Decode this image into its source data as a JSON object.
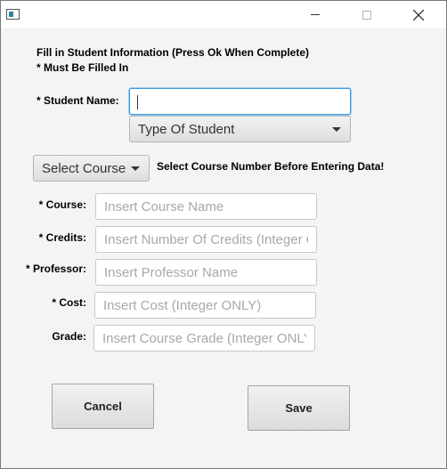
{
  "window": {
    "minimize_icon": "minimize-icon",
    "maximize_icon": "maximize-icon",
    "close_icon": "close-icon",
    "app_icon": "app-icon"
  },
  "header": {
    "instructions": "Fill in Student Information (Press Ok When Complete)",
    "required_note": "* Must Be Filled In"
  },
  "student": {
    "name_label": "* Student Name:",
    "name_value": "",
    "type_combo": "Type Of Student"
  },
  "course_select": {
    "combo": "Select Course",
    "hint": "Select Course Number Before Entering Data!"
  },
  "fields": [
    {
      "label": "* Course:",
      "placeholder": "Insert Course Name"
    },
    {
      "label": "* Credits:",
      "placeholder": "Insert Number Of Credits (Integer ONLY)"
    },
    {
      "label": "* Professor:",
      "placeholder": "Insert Professor Name"
    },
    {
      "label": "* Cost:",
      "placeholder": "Insert Cost (Integer ONLY)"
    },
    {
      "label": "Grade:",
      "placeholder": "Insert Course Grade (Integer ONLY)"
    }
  ],
  "buttons": {
    "cancel": "Cancel",
    "save": "Save"
  },
  "colors": {
    "focus": "#3a9ad9",
    "background": "#f4f4f4"
  }
}
